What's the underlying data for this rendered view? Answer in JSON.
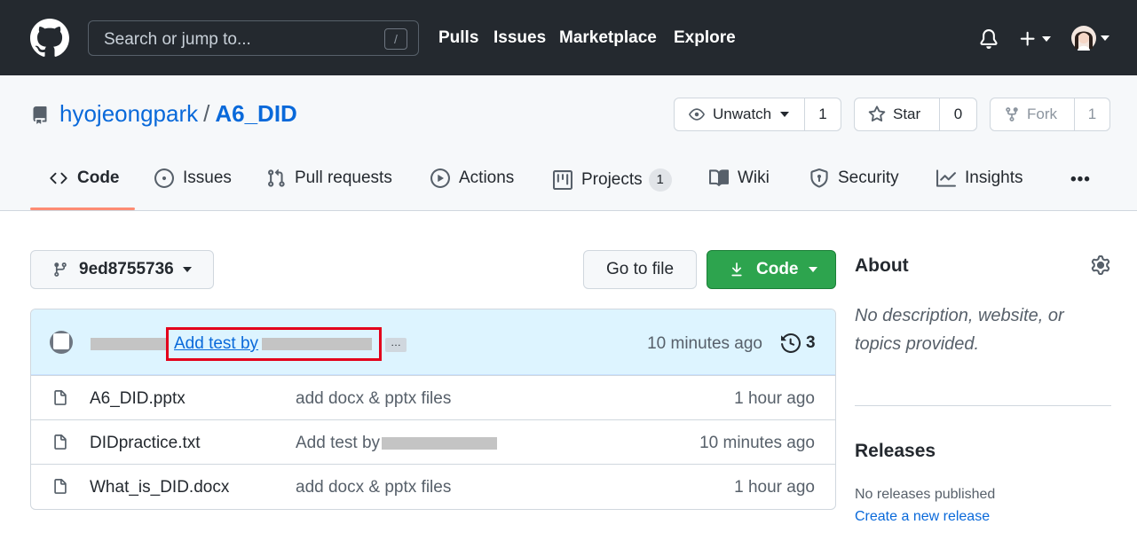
{
  "header": {
    "search_placeholder": "Search or jump to...",
    "search_shortcut": "/",
    "nav": [
      "Pulls",
      "Issues",
      "Marketplace",
      "Explore"
    ],
    "icons": [
      "github-logo-icon",
      "bell-icon",
      "plus-icon",
      "avatar"
    ]
  },
  "repo": {
    "owner": "hyojeongpark",
    "separator": "/",
    "name": "A6_DID",
    "watch_label": "Unwatch",
    "watch_count": "1",
    "star_label": "Star",
    "star_count": "0",
    "fork_label": "Fork",
    "fork_count": "1"
  },
  "tabs": {
    "code": "Code",
    "issues": "Issues",
    "pulls": "Pull requests",
    "actions": "Actions",
    "projects": "Projects",
    "projects_count": "1",
    "wiki": "Wiki",
    "security": "Security",
    "insights": "Insights",
    "more": "•••"
  },
  "toolbar": {
    "branch": "9ed8755736",
    "goto_file": "Go to file",
    "code": "Code"
  },
  "commit": {
    "message": "Add test by",
    "ellipsis": "…",
    "time": "10 minutes ago",
    "history_count": "3"
  },
  "files": [
    {
      "name": "A6_DID.pptx",
      "message": "add docx & pptx files",
      "time": "1 hour ago"
    },
    {
      "name": "DIDpractice.txt",
      "message": "Add test by",
      "time": "10 minutes ago"
    },
    {
      "name": "What_is_DID.docx",
      "message": "add docx & pptx files",
      "time": "1 hour ago"
    }
  ],
  "sidebar": {
    "about_title": "About",
    "about_desc": "No description, website, or topics provided.",
    "releases_title": "Releases",
    "releases_none": "No releases published",
    "releases_link": "Create a new release"
  },
  "colors": {
    "header_bg": "#24292f",
    "link": "#0969da",
    "code_button": "#2da44e",
    "tab_underline": "#fd8c73",
    "highlight_box": "#e3001b",
    "commit_bar_bg": "#ddf4ff"
  }
}
